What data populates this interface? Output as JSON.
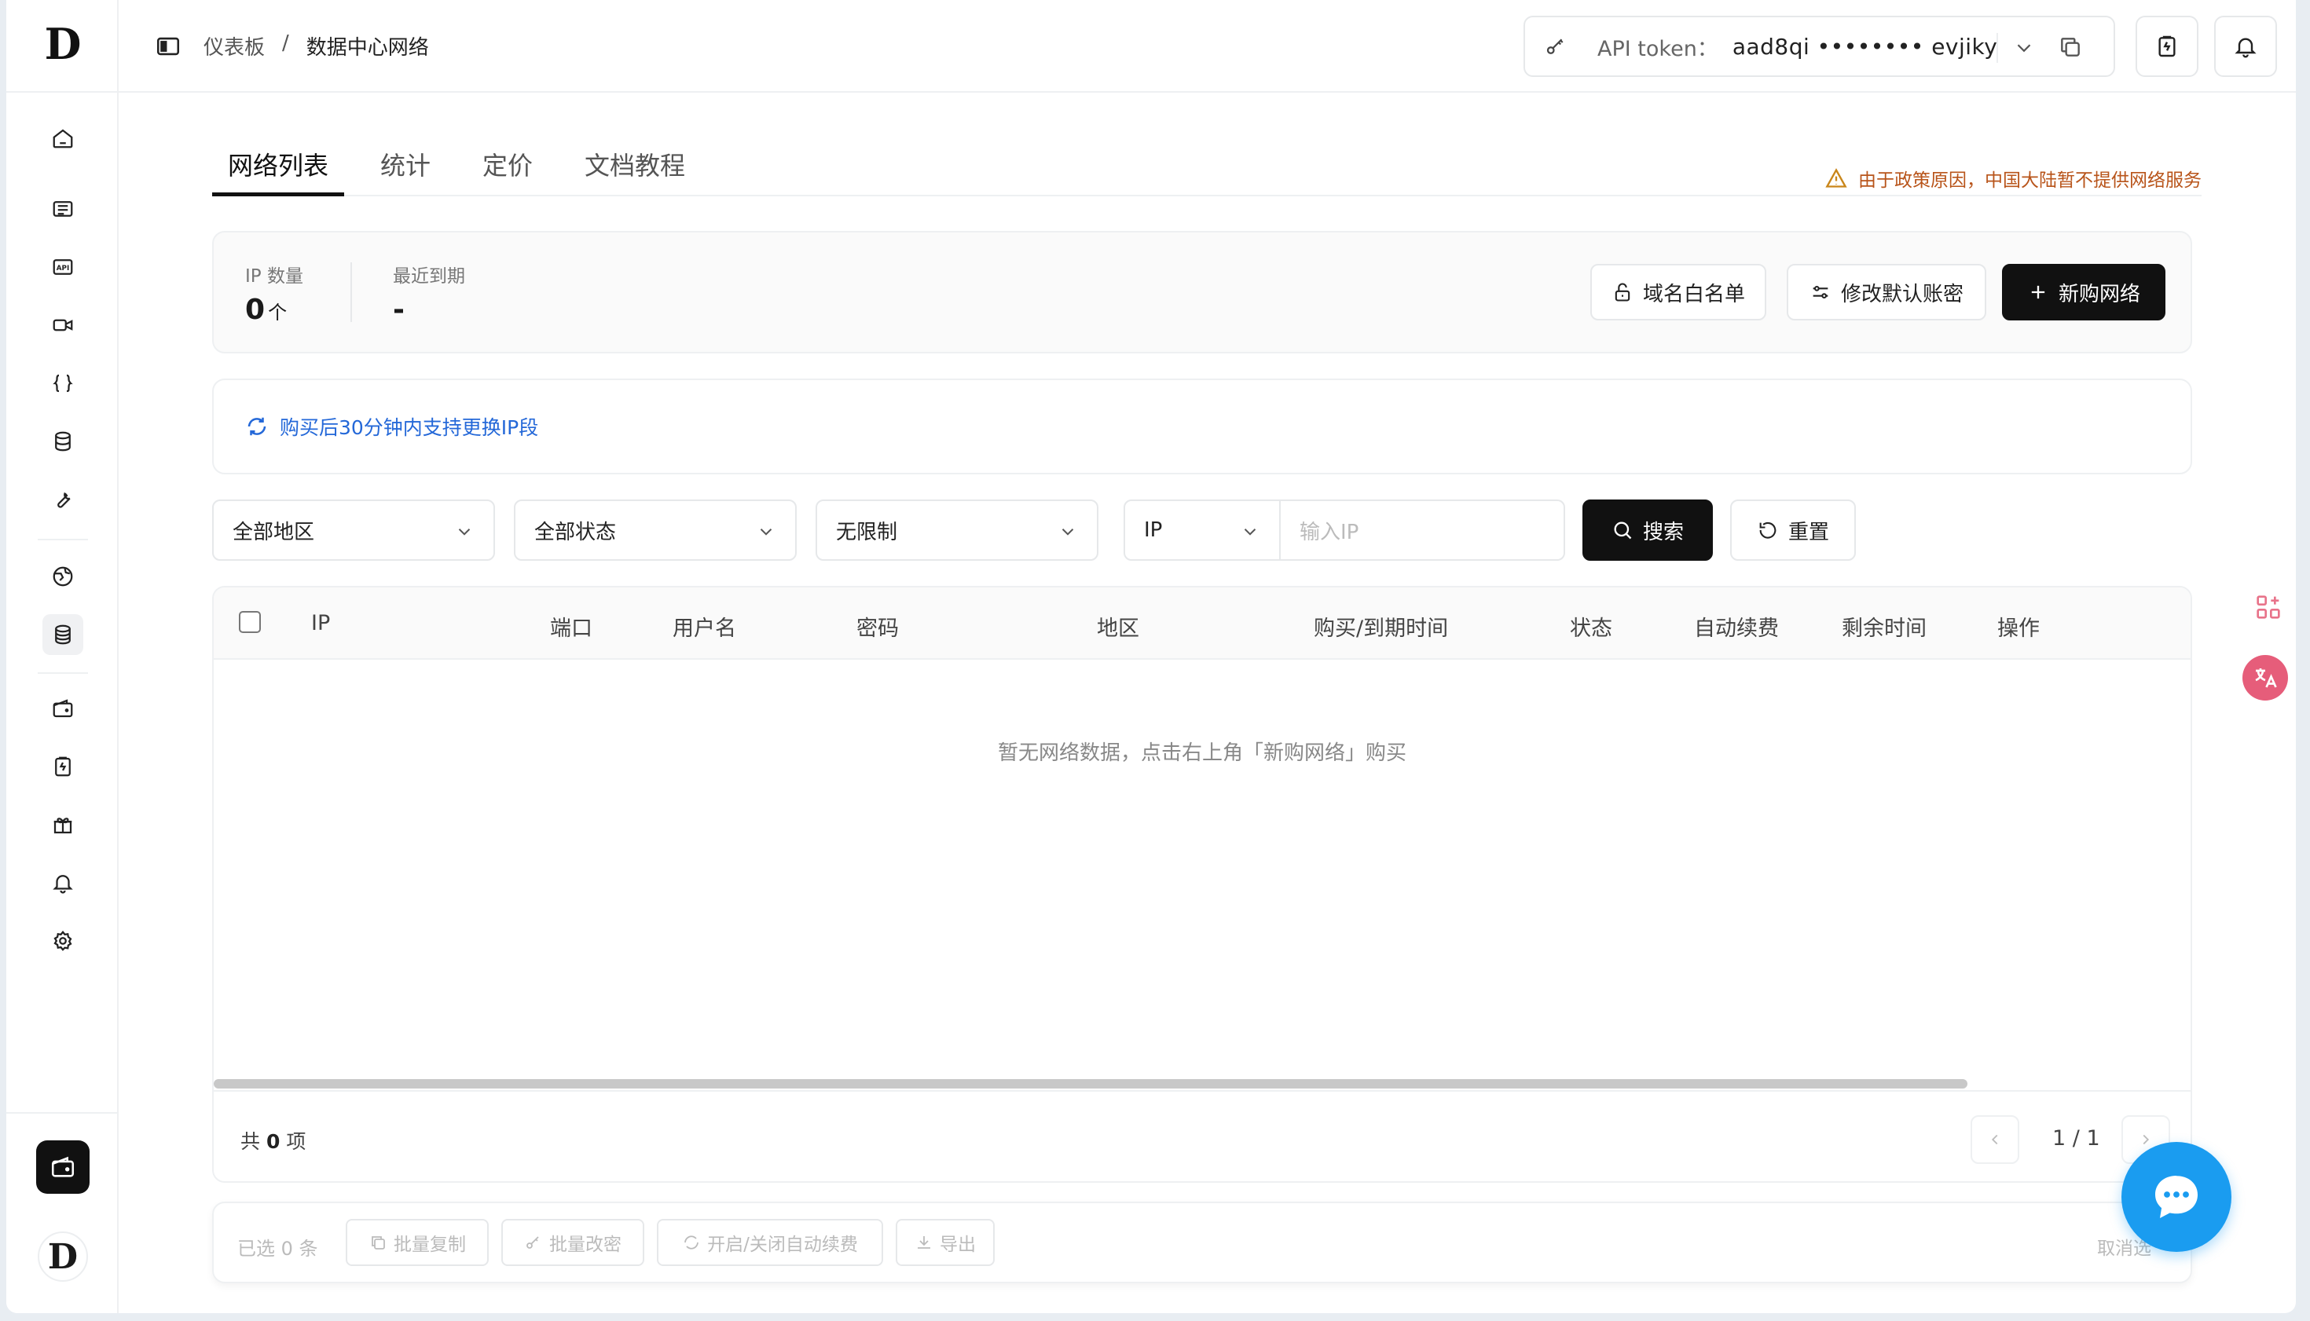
{
  "app": {
    "logo_letter": "D",
    "avatar_letter": "D"
  },
  "breadcrumb": {
    "parent": "仪表板",
    "separator": "/",
    "current": "数据中心网络"
  },
  "token": {
    "label": "API token：",
    "value": "aad8qi •••••••• evjiky"
  },
  "tabs": [
    {
      "label": "网络列表",
      "active": true
    },
    {
      "label": "统计",
      "active": false
    },
    {
      "label": "定价",
      "active": false
    },
    {
      "label": "文档教程",
      "active": false
    }
  ],
  "notice": "由于政策原因，中国大陆暂不提供网络服务",
  "stats": {
    "ip_count_label": "IP 数量",
    "ip_count_value": "0",
    "ip_count_unit": "个",
    "expiry_label": "最近到期",
    "expiry_value": "-"
  },
  "actions": {
    "whitelist": "域名白名单",
    "change_password": "修改默认账密",
    "buy": "新购网络"
  },
  "info": "购买后30分钟内支持更换IP段",
  "filters": {
    "region": "全部地区",
    "status": "全部状态",
    "limit": "无限制",
    "field": "IP",
    "input_placeholder": "输入IP",
    "search": "搜索",
    "reset": "重置"
  },
  "table": {
    "columns": [
      "IP",
      "端口",
      "用户名",
      "密码",
      "地区",
      "购买/到期时间",
      "状态",
      "自动续费",
      "剩余时间",
      "操作"
    ],
    "empty": "暂无网络数据，点击右上角「新购网络」购买",
    "total_prefix": "共",
    "total_count": "0",
    "total_suffix": "项",
    "page": "1 / 1"
  },
  "batch": {
    "selected": "已选 0 条",
    "copy": "批量复制",
    "change_pwd": "批量改密",
    "auto_renew": "开启/关闭自动续费",
    "export": "导出",
    "cancel": "取消选"
  },
  "colors": {
    "accent": "#111111",
    "info": "#2468d8",
    "warning": "#b8541a",
    "chat": "#1a9cf0",
    "translate": "#e65d7a"
  }
}
